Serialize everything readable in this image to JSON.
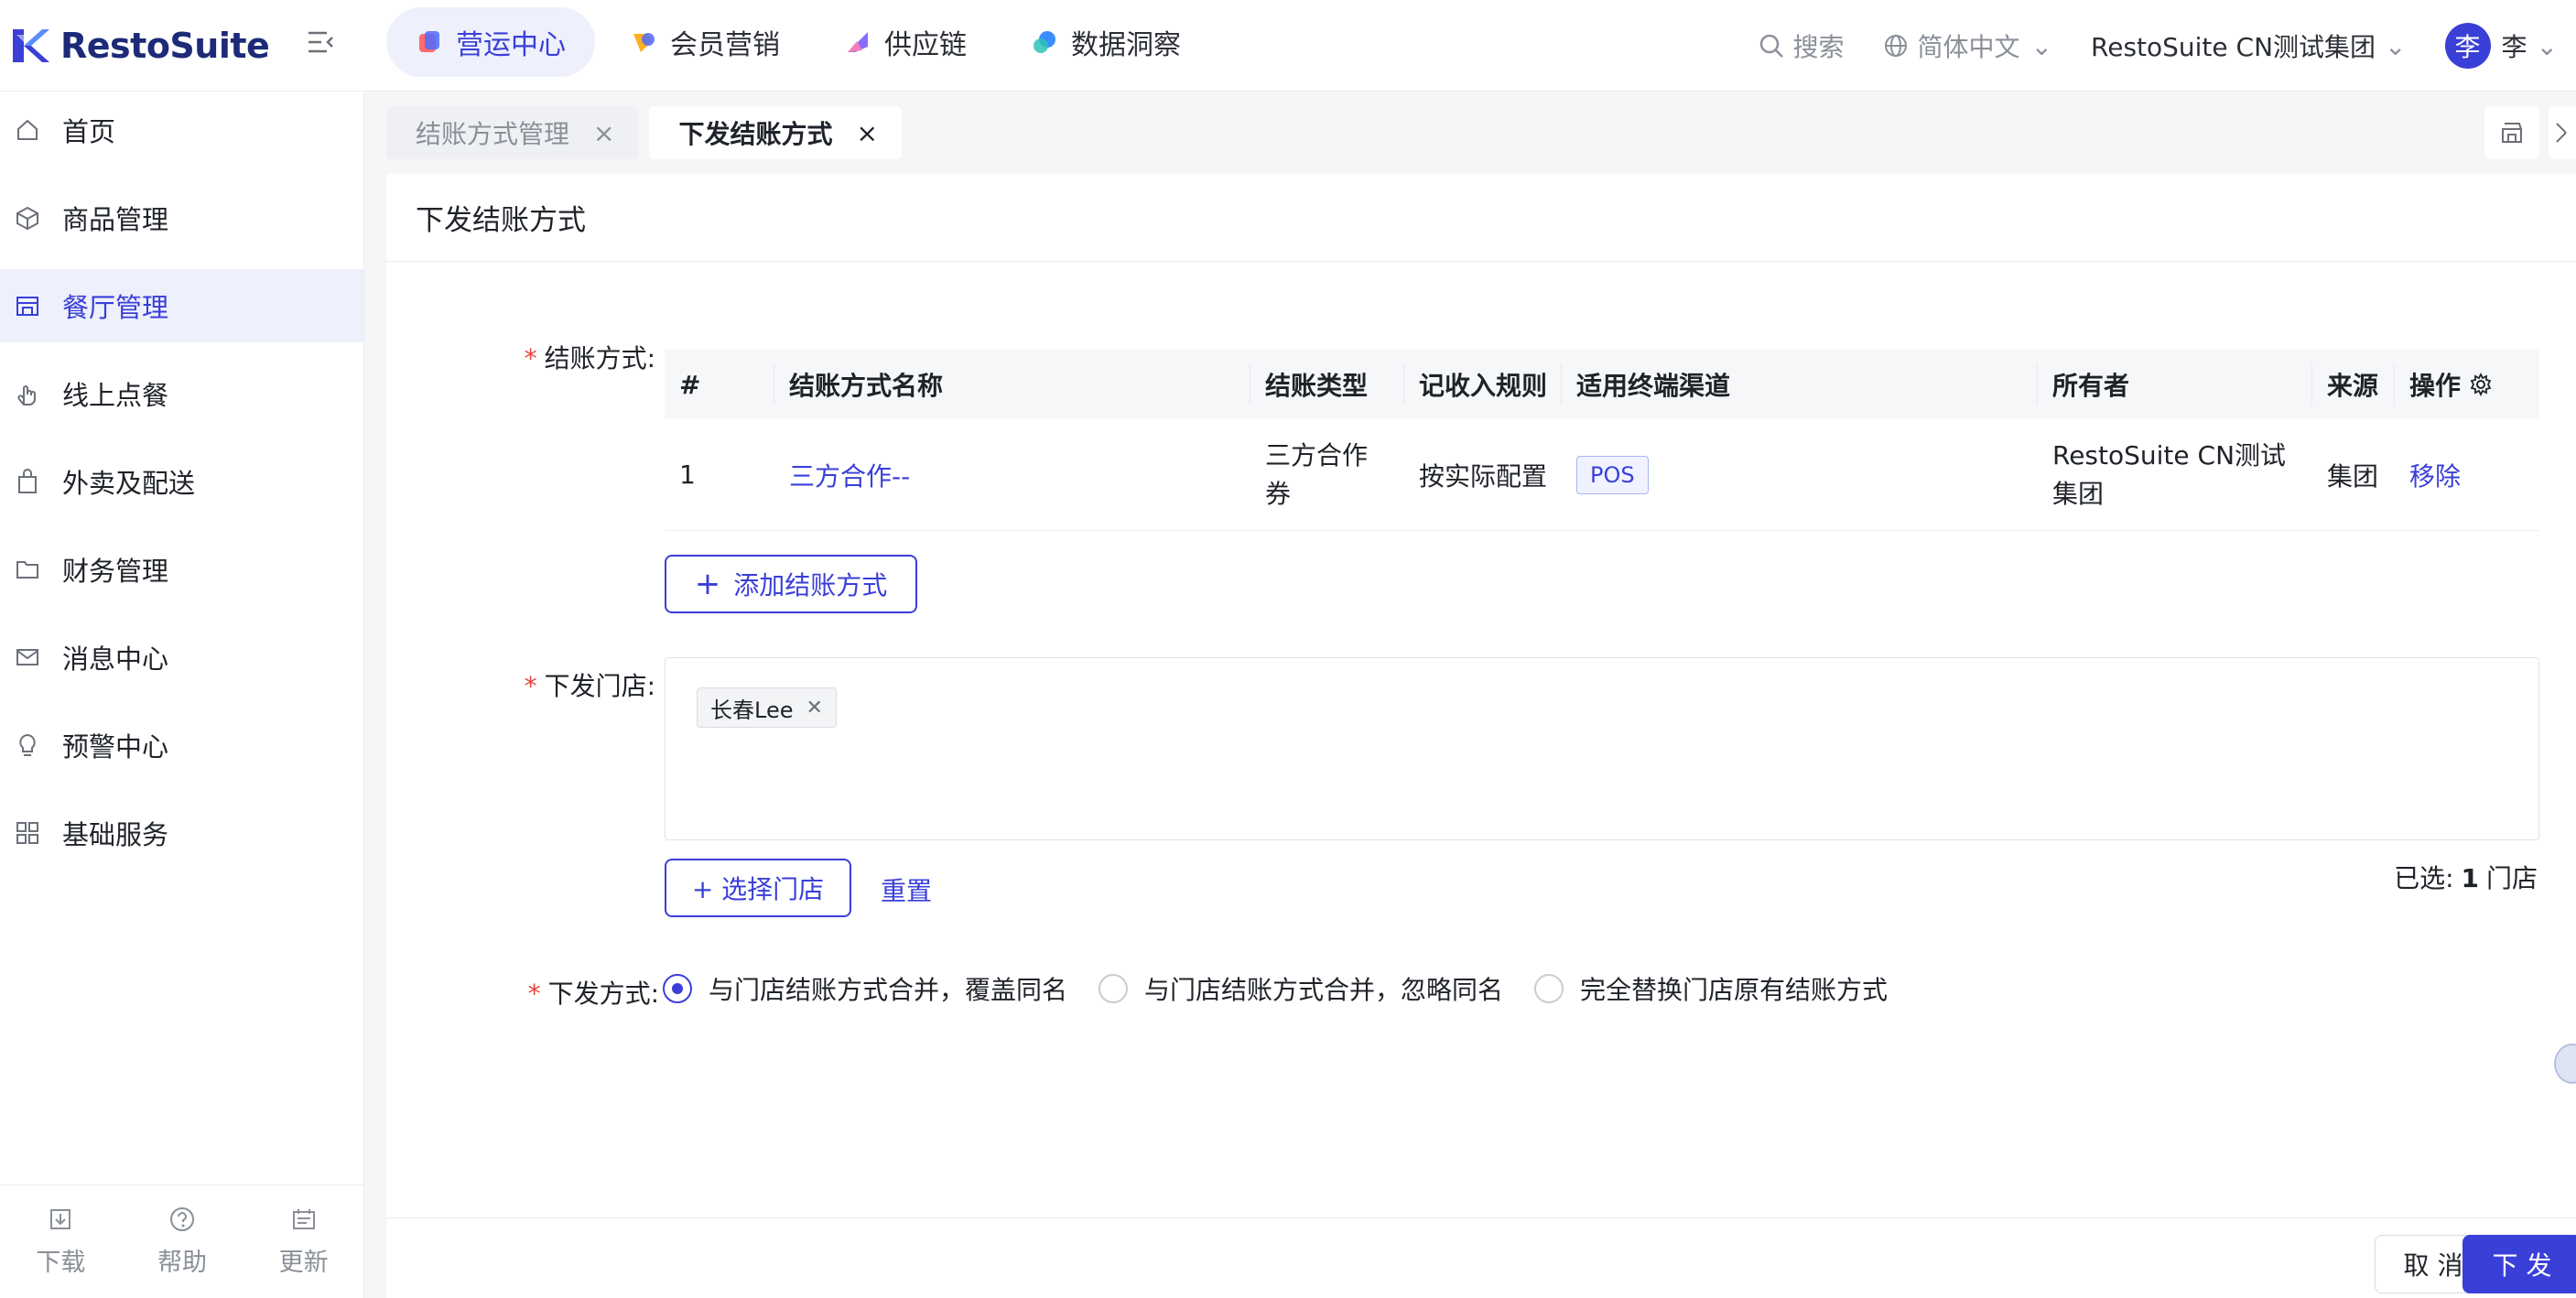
{
  "brand": {
    "name": "RestoSuite"
  },
  "top_nav": [
    {
      "label": "营运中心",
      "active": true,
      "icon": "ops-icon",
      "color": "#ff6b6b"
    },
    {
      "label": "会员营销",
      "active": false,
      "icon": "member-icon",
      "color": "#ffb020"
    },
    {
      "label": "供应链",
      "active": false,
      "icon": "supply-icon",
      "color": "#8b6cff"
    },
    {
      "label": "数据洞察",
      "active": false,
      "icon": "insight-icon",
      "color": "#3a8dff"
    }
  ],
  "top_right": {
    "search": "搜索",
    "language": "简体中文",
    "org": "RestoSuite CN测试集团",
    "avatar_char": "李",
    "user": "李"
  },
  "sidebar": {
    "items": [
      {
        "label": "首页",
        "icon": "home-icon"
      },
      {
        "label": "商品管理",
        "icon": "box-icon"
      },
      {
        "label": "餐厅管理",
        "icon": "store-icon",
        "active": true
      },
      {
        "label": "线上点餐",
        "icon": "hand-icon"
      },
      {
        "label": "外卖及配送",
        "icon": "bag-icon"
      },
      {
        "label": "财务管理",
        "icon": "folder-icon"
      },
      {
        "label": "消息中心",
        "icon": "mail-icon"
      },
      {
        "label": "预警中心",
        "icon": "bulb-icon"
      },
      {
        "label": "基础服务",
        "icon": "grid-icon"
      }
    ],
    "footer": [
      {
        "label": "下载",
        "icon": "download-icon"
      },
      {
        "label": "帮助",
        "icon": "help-icon"
      },
      {
        "label": "更新",
        "icon": "update-icon"
      }
    ]
  },
  "tabs": [
    {
      "label": "结账方式管理",
      "active": false
    },
    {
      "label": "下发结账方式",
      "active": true
    }
  ],
  "page": {
    "title": "下发结账方式",
    "label_payment": "结账方式:",
    "label_store": "下发门店:",
    "label_mode": "下发方式:",
    "table": {
      "headers": [
        "#",
        "结账方式名称",
        "结账类型",
        "记收入规则",
        "适用终端渠道",
        "所有者",
        "来源",
        "操作"
      ],
      "rows": [
        {
          "index": "1",
          "name": "三方合作--",
          "type": "三方合作券",
          "rule": "按实际配置",
          "channel": "POS",
          "owner": "RestoSuite CN测试集团",
          "source": "集团",
          "action": "移除"
        }
      ]
    },
    "add_button": "添加结账方式",
    "stores": [
      {
        "name": "长春Lee"
      }
    ],
    "select_store_button": "+ 选择门店",
    "reset_link": "重置",
    "selected_prefix": "已选:",
    "selected_count": "1",
    "selected_suffix": "门店",
    "modes": [
      {
        "label": "与门店结账方式合并，覆盖同名",
        "checked": true
      },
      {
        "label": "与门店结账方式合并，忽略同名",
        "checked": false
      },
      {
        "label": "完全替换门店原有结账方式",
        "checked": false
      }
    ],
    "cancel_button": "取 消",
    "submit_button": "下 发"
  },
  "colors": {
    "accent": "#3a3fd8",
    "required": "#e8443a"
  }
}
